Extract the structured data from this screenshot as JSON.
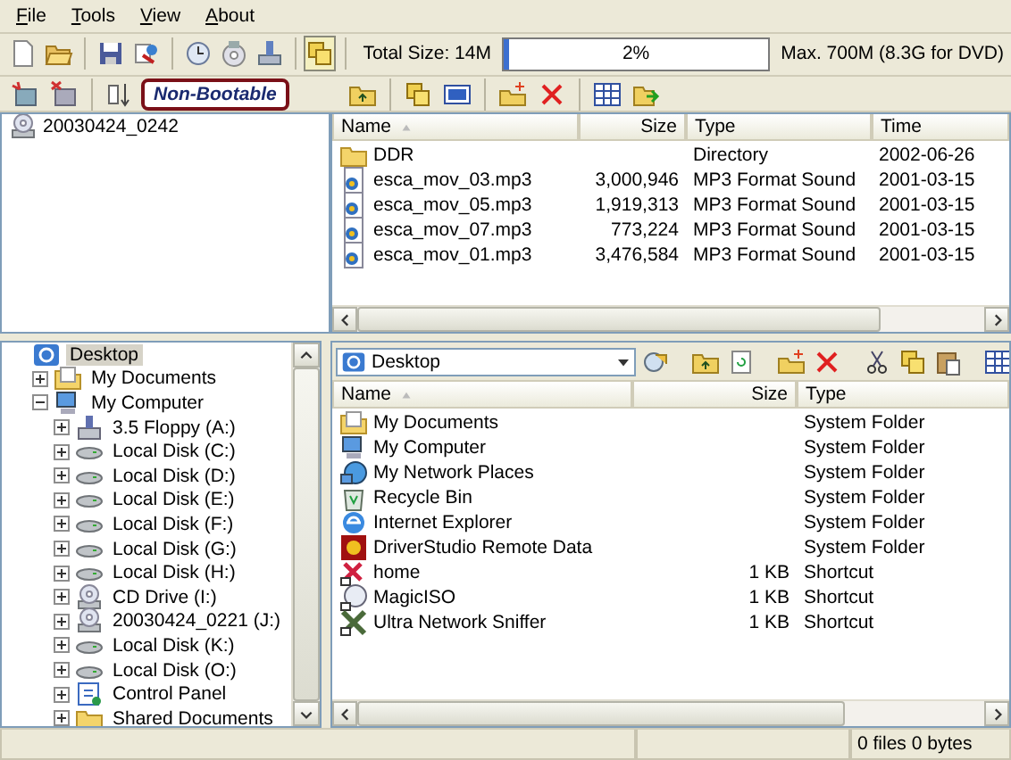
{
  "menu": [
    {
      "label": "File"
    },
    {
      "label": "Tools"
    },
    {
      "label": "View"
    },
    {
      "label": "About"
    }
  ],
  "toolbar": {
    "toggle_on": true,
    "total_size": "Total Size: 14M",
    "progress": {
      "level": 0.02,
      "text": "2%"
    },
    "max_size": "Max. 700M (8.3G for DVD)"
  },
  "boot_status": "Non-Bootable",
  "image_root": "20030424_0242",
  "image_list": {
    "columns": [
      {
        "label": "Name",
        "sorted": true
      },
      {
        "label": "Size",
        "sorted": false
      },
      {
        "label": "Type",
        "sorted": false
      },
      {
        "label": "Time",
        "sorted": false
      }
    ],
    "rows": [
      {
        "kind": "folder",
        "name": "DDR",
        "type": "Directory",
        "time": "2002-06-26"
      },
      {
        "kind": "audio",
        "name": "esca_mov_03.mp3",
        "size": "3,000,946",
        "type": "MP3 Format Sound",
        "time": "2001-03-15"
      },
      {
        "kind": "audio",
        "name": "esca_mov_05.mp3",
        "size": "1,919,313",
        "type": "MP3 Format Sound",
        "time": "2001-03-15"
      },
      {
        "kind": "audio",
        "name": "esca_mov_07.mp3",
        "size": "773,224",
        "type": "MP3 Format Sound",
        "time": "2001-03-15"
      },
      {
        "kind": "audio",
        "name": "esca_mov_01.mp3",
        "size": "3,476,584",
        "type": "MP3 Format Sound",
        "time": "2001-03-15"
      }
    ]
  },
  "folder_tree": [
    {
      "label": "Desktop",
      "kind": "desktop",
      "selected": true,
      "children": [
        {
          "label": "My Documents",
          "kind": "documents",
          "selected": false,
          "expanded": false
        },
        {
          "label": "My Computer",
          "kind": "computer",
          "selected": false,
          "expanded": true,
          "children": [
            {
              "label": "3.5 Floppy (A:)",
              "kind": "floppy",
              "selected": false,
              "expanded": false
            },
            {
              "label": "Local Disk (C:)",
              "kind": "disk",
              "selected": false,
              "expanded": false
            },
            {
              "label": "Local Disk (D:)",
              "kind": "disk",
              "selected": false,
              "expanded": false
            },
            {
              "label": "Local Disk (E:)",
              "kind": "disk",
              "selected": false,
              "expanded": false
            },
            {
              "label": "Local Disk (F:)",
              "kind": "disk",
              "selected": false,
              "expanded": false
            },
            {
              "label": "Local Disk (G:)",
              "kind": "disk",
              "selected": false,
              "expanded": false
            },
            {
              "label": "Local Disk (H:)",
              "kind": "disk",
              "selected": false,
              "expanded": false
            },
            {
              "label": "CD Drive (I:)",
              "kind": "cd",
              "selected": false,
              "expanded": false
            },
            {
              "label": "20030424_0221 (J:)",
              "kind": "cd",
              "selected": false,
              "expanded": false
            },
            {
              "label": "Local Disk (K:)",
              "kind": "disk",
              "selected": false,
              "expanded": false
            },
            {
              "label": "Local Disk (O:)",
              "kind": "disk",
              "selected": false,
              "expanded": false
            },
            {
              "label": "Control Panel",
              "kind": "control",
              "selected": false,
              "expanded": false
            },
            {
              "label": "Shared Documents",
              "kind": "folder",
              "selected": false,
              "expanded": false
            }
          ]
        }
      ]
    }
  ],
  "address": "Desktop",
  "file_list": {
    "columns": [
      {
        "label": "Name",
        "sorted": true
      },
      {
        "label": "Size",
        "sorted": false
      },
      {
        "label": "Type",
        "sorted": false
      }
    ],
    "rows": [
      {
        "kind": "documents",
        "name": "My Documents",
        "type": "System Folder"
      },
      {
        "kind": "computer",
        "name": "My Computer",
        "type": "System Folder"
      },
      {
        "kind": "network",
        "name": "My Network Places",
        "type": "System Folder"
      },
      {
        "kind": "recycle",
        "name": "Recycle Bin",
        "type": "System Folder"
      },
      {
        "kind": "browser",
        "name": "Internet Explorer",
        "type": "System Folder"
      },
      {
        "kind": "app",
        "name": "DriverStudio Remote Data",
        "type": "System Folder"
      },
      {
        "kind": "shortcut",
        "name": "home",
        "size": "1 KB",
        "type": "Shortcut"
      },
      {
        "kind": "disc-shortcut",
        "name": "MagicISO",
        "size": "1 KB",
        "type": "Shortcut"
      },
      {
        "kind": "tool-shortcut",
        "name": "Ultra Network Sniffer",
        "size": "1 KB",
        "type": "Shortcut"
      }
    ]
  },
  "status": "0 files  0 bytes"
}
